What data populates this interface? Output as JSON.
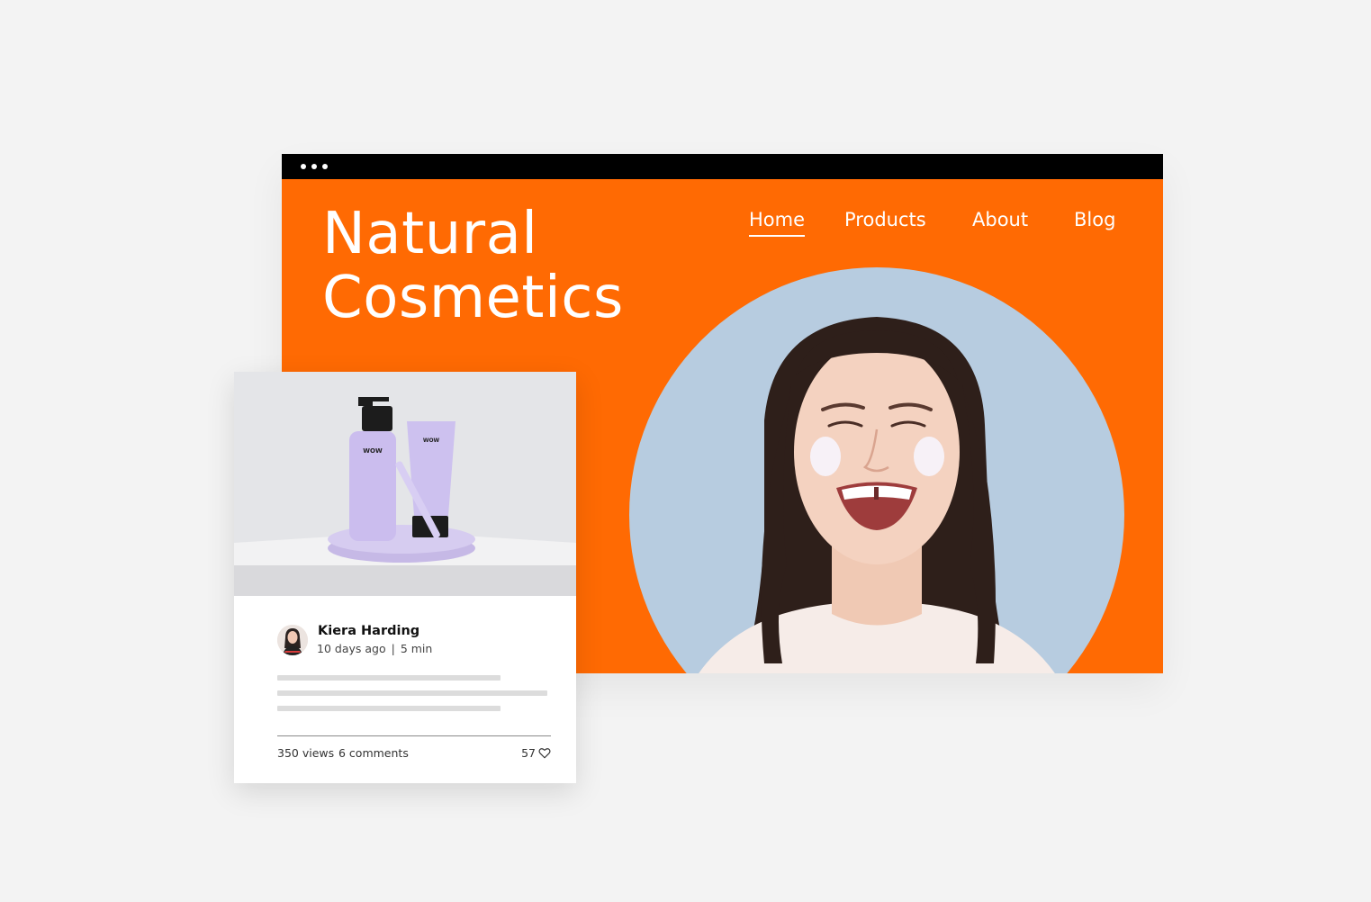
{
  "site": {
    "title_line1": "Natural",
    "title_line2": "Cosmetics",
    "brand_color": "#ff6a03",
    "nav": {
      "items": [
        {
          "label": "Home",
          "active": true
        },
        {
          "label": "Products",
          "active": false
        },
        {
          "label": "About",
          "active": false
        },
        {
          "label": "Blog",
          "active": false
        }
      ]
    },
    "hero_image": "smiling-woman-with-face-cream"
  },
  "blog_card": {
    "image": "cosmetic-products-on-podium",
    "product_brand": "WOW",
    "author": {
      "name": "Kiera Harding",
      "time_ago": "10 days ago",
      "separator": "|",
      "read_time": "5 min"
    },
    "stats": {
      "views": "350 views",
      "comments": "6 comments",
      "likes": "57"
    },
    "like_icon": "heart-icon"
  }
}
